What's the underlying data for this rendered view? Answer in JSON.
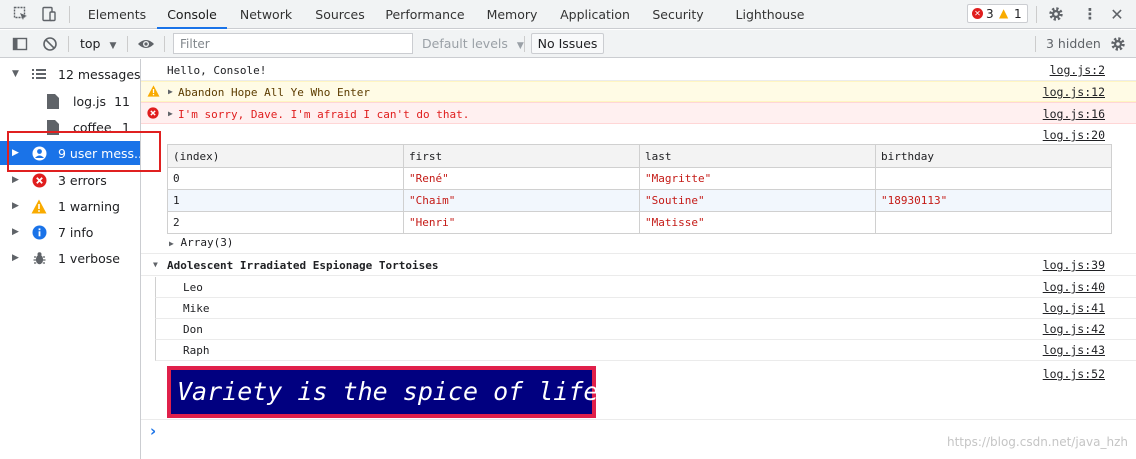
{
  "tabs": [
    "Elements",
    "Console",
    "Network",
    "Sources",
    "Performance",
    "Memory",
    "Application",
    "Security",
    "Lighthouse"
  ],
  "active_tab": "Console",
  "issues": {
    "errors": "3",
    "warnings": "1"
  },
  "toolbar": {
    "context": "top",
    "filter_placeholder": "Filter",
    "levels": "Default levels",
    "no_issues": "No Issues",
    "hidden": "3 hidden"
  },
  "sidebar": [
    {
      "label": "12 messages",
      "count": "",
      "icon": "list-icon"
    },
    {
      "label": "log.js",
      "count": "11",
      "icon": "file-icon"
    },
    {
      "label": "coffee",
      "count": "1",
      "icon": "file-icon"
    },
    {
      "label": "9 user mess...",
      "count": "",
      "icon": "user-icon"
    },
    {
      "label": "3 errors",
      "count": "",
      "icon": "error-icon"
    },
    {
      "label": "1 warning",
      "count": "",
      "icon": "warning-icon"
    },
    {
      "label": "7 info",
      "count": "",
      "icon": "info-icon"
    },
    {
      "label": "1 verbose",
      "count": "",
      "icon": "bug-icon"
    }
  ],
  "messages": {
    "hello": {
      "text": "Hello, Console!",
      "src": "log.js:2"
    },
    "warning": {
      "text": "Abandon Hope All Ye Who Enter",
      "src": "log.js:12"
    },
    "error": {
      "text": "I'm sorry, Dave. I'm afraid I can't do that.",
      "src": "log.js:16"
    },
    "table_src": "log.js:20",
    "table_footer": "Array(3)",
    "group": {
      "title": "Adolescent Irradiated Espionage Tortoises",
      "src": "log.js:39"
    },
    "group_items": [
      {
        "text": "Leo",
        "src": "log.js:40"
      },
      {
        "text": "Mike",
        "src": "log.js:41"
      },
      {
        "text": "Don",
        "src": "log.js:42"
      },
      {
        "text": "Raph",
        "src": "log.js:43"
      }
    ],
    "styled": {
      "text": "Variety is the spice of life",
      "src": "log.js:52"
    }
  },
  "table": {
    "headers": [
      "(index)",
      "first",
      "last",
      "birthday"
    ],
    "rows": [
      [
        "0",
        "\"René\"",
        "\"Magritte\"",
        ""
      ],
      [
        "1",
        "\"Chaim\"",
        "\"Soutine\"",
        "\"18930113\""
      ],
      [
        "2",
        "\"Henri\"",
        "\"Matisse\"",
        ""
      ]
    ]
  },
  "prompt": "›",
  "watermark": "https://blog.csdn.net/java_hzh",
  "colors": {
    "accent": "#1a73e8",
    "error": "#e01e1e",
    "warning": "#f9ab00",
    "styled_bg": "#010080",
    "styled_border": "#e0204a"
  }
}
